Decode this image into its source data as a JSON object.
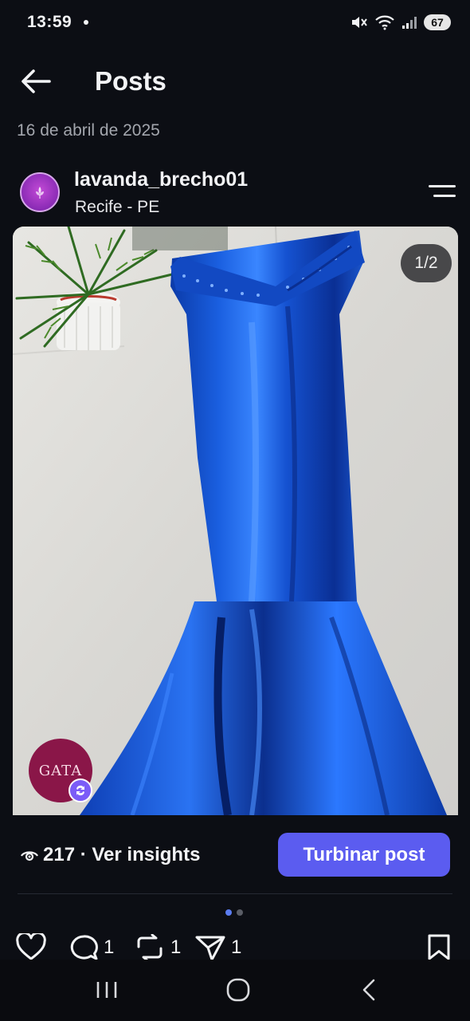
{
  "status_bar": {
    "time": "13:59",
    "battery": "67",
    "icons": [
      "mute-vibrate-icon",
      "wifi-icon",
      "signal-icon",
      "battery-icon"
    ]
  },
  "header": {
    "title": "Posts",
    "back_icon": "arrow-left-icon"
  },
  "post": {
    "date": "16 de abril de 2025",
    "author": {
      "username": "lavanda_brecho01",
      "location": "Recife - PE",
      "avatar_icon": "avatar-logo"
    },
    "menu_icon": "hamburger-menu-icon",
    "media": {
      "counter": "1/2",
      "description_icon": "photo-blue-satin-mermaid-dress",
      "seller_badge": "GATA",
      "badge_sync_icon": "sync-icon"
    },
    "views": "217",
    "insights_label": "217 · Ver insights",
    "boost_label": "Turbinar post",
    "carousel": {
      "current": 1,
      "total": 2
    },
    "actions": {
      "like": {
        "icon": "heart-icon",
        "count": ""
      },
      "comment": {
        "icon": "comment-icon",
        "count": "1"
      },
      "repost": {
        "icon": "repost-icon",
        "count": "1"
      },
      "share": {
        "icon": "share-icon",
        "count": "1"
      },
      "save": {
        "icon": "bookmark-icon",
        "count": ""
      }
    }
  },
  "nav_bar": {
    "buttons": [
      "recents-icon",
      "home-icon",
      "back-icon"
    ]
  },
  "colors": {
    "background": "#0c0e14",
    "accent": "#5b5cf0",
    "text_primary": "#f2f3f5",
    "text_secondary": "#a3a6ad",
    "dot_active": "#5b7cf0",
    "dot_inactive": "#5a5d66"
  }
}
